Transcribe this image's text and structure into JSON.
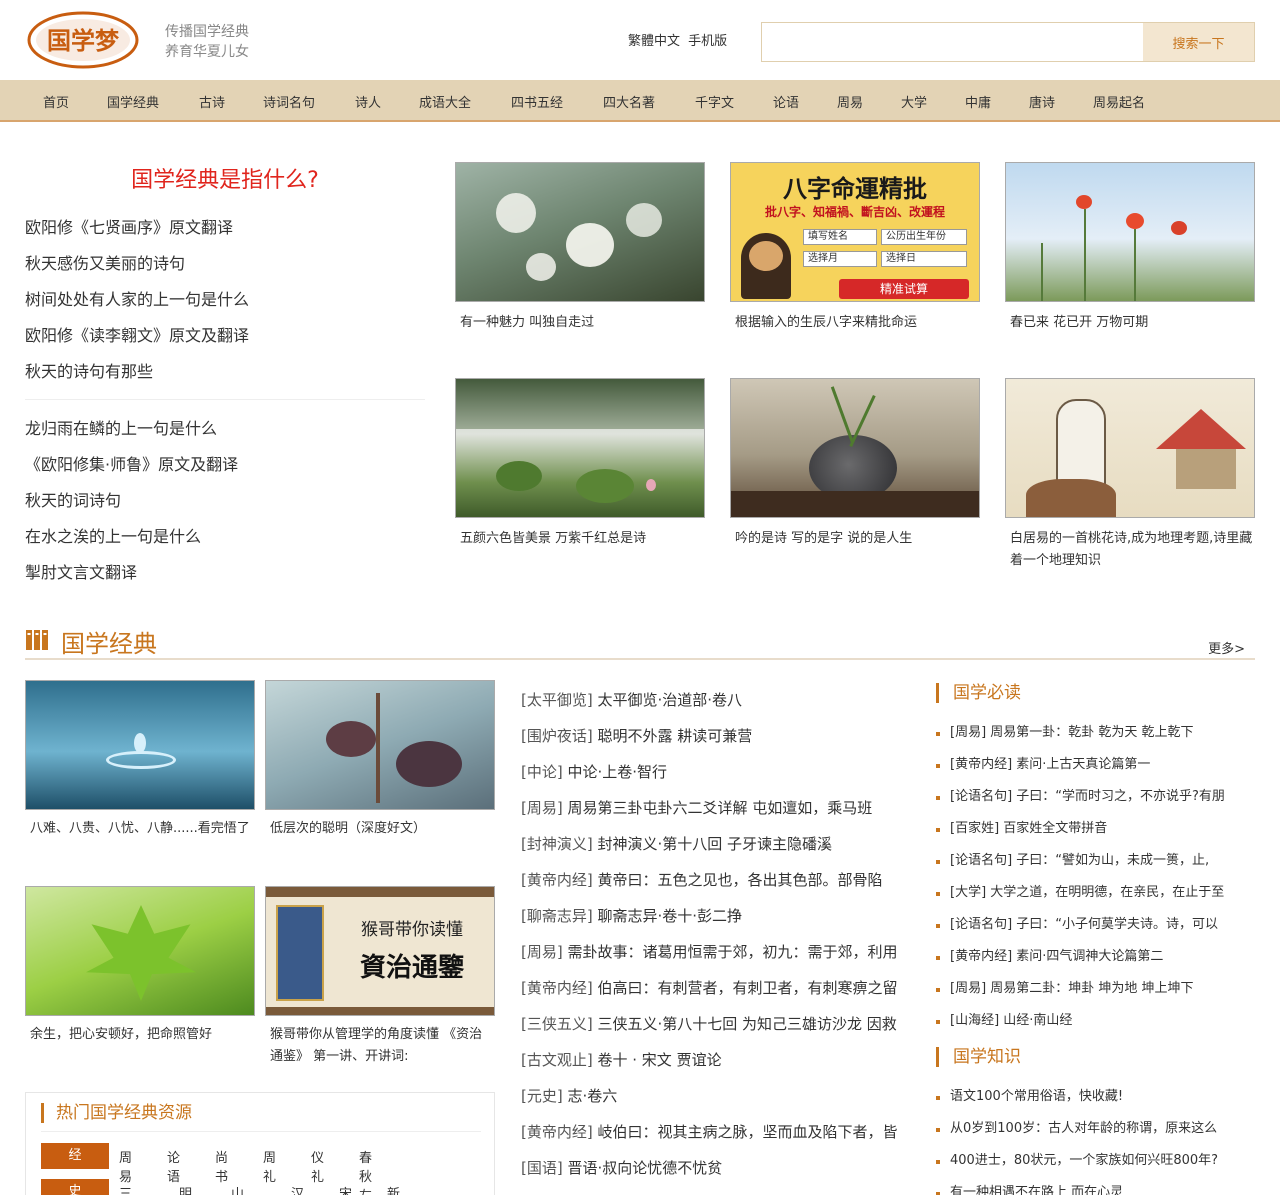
{
  "header": {
    "logo_text": "国学梦",
    "slogan_line1": "传播国学经典",
    "slogan_line2": "养育华夏儿女",
    "link_traditional": "繁體中文",
    "link_mobile": "手机版",
    "search_placeholder": "",
    "search_button": "搜索一下"
  },
  "nav": [
    "首页",
    "国学经典",
    "古诗",
    "诗词名句",
    "诗人",
    "成语大全",
    "四书五经",
    "四大名著",
    "千字文",
    "论语",
    "周易",
    "大学",
    "中庸",
    "唐诗",
    "周易起名"
  ],
  "lead": {
    "title": "国学经典是指什么?",
    "group1": [
      "欧阳修《七贤画序》原文翻译",
      "秋天感伤又美丽的诗句",
      "树间处处有人家的上一句是什么",
      "欧阳修《读李翱文》原文及翻译",
      "秋天的诗句有那些"
    ],
    "group2": [
      "龙归雨在鳞的上一句是什么",
      "《欧阳修集·师鲁》原文及翻译",
      "秋天的词诗句",
      "在水之涘的上一句是什么",
      "掣肘文言文翻译"
    ]
  },
  "features": [
    {
      "caption": "有一种魅力 叫独自走过",
      "icon": "blossom-photo"
    },
    {
      "caption": "根据输入的生辰八字来精批命运",
      "icon": "fortune-ad",
      "ad_title": "八字命運精批",
      "ad_sub": "批八字、知福禍、斷吉凶、改運程",
      "ad_f1": "填写姓名",
      "ad_f2": "公历出生年份",
      "ad_f3": "选择月",
      "ad_f4": "选择日",
      "ad_btn": "精准试算"
    },
    {
      "caption": "春已来 花已开 万物可期",
      "icon": "poppy-photo"
    },
    {
      "caption": "五颜六色皆美景 万紫千红总是诗",
      "icon": "lotus-photo"
    },
    {
      "caption": "吟的是诗 写的是字 说的是人生",
      "icon": "fossil-photo"
    },
    {
      "caption": "白居易的一首桃花诗,成为地理考题,诗里藏着一个地理知识",
      "icon": "painting-photo"
    }
  ],
  "section": {
    "title": "国学经典",
    "more": "更多>"
  },
  "classics": [
    {
      "caption": "八难、八贵、八忧、八静......看完悟了",
      "icon": "water-drop-photo"
    },
    {
      "caption": "低层次的聪明（深度好文）",
      "icon": "frost-plant-photo"
    },
    {
      "caption": "余生，把心安顿好，把命照管好",
      "icon": "maple-leaf-photo"
    },
    {
      "caption": "猴哥带你从管理学的角度读懂 《资治通鉴》 第一讲、开讲词:",
      "icon": "book-cover-photo",
      "banner1": "猴哥带你读懂",
      "banner2": "資治通鑒"
    }
  ],
  "articles": [
    {
      "cat": "[太平御览]",
      "title": "太平御览·治道部·卷八"
    },
    {
      "cat": "[围炉夜话]",
      "title": "聪明不外露 耕读可兼营"
    },
    {
      "cat": "[中论]",
      "title": "中论·上卷·智行"
    },
    {
      "cat": "[周易]",
      "title": "周易第三卦屯卦六二爻详解 屯如邅如，乘马班"
    },
    {
      "cat": "[封神演义]",
      "title": "封神演义·第十八回 子牙谏主隐磻溪"
    },
    {
      "cat": "[黄帝内经]",
      "title": "黄帝曰：五色之见也，各出其色部。部骨陷"
    },
    {
      "cat": "[聊斋志异]",
      "title": "聊斋志异·卷十·彭二挣"
    },
    {
      "cat": "[周易]",
      "title": "需卦故事：诸葛用恒需于郊，初九：需于郊，利用"
    },
    {
      "cat": "[黄帝内经]",
      "title": "伯高曰：有刺营者，有刺卫者，有刺寒痹之留"
    },
    {
      "cat": "[三侠五义]",
      "title": "三侠五义·第八十七回 为知己三雄访沙龙 因救"
    },
    {
      "cat": "[古文观止]",
      "title": "卷十 · 宋文 贾谊论"
    },
    {
      "cat": "[元史]",
      "title": "志·卷六"
    },
    {
      "cat": "[黄帝内经]",
      "title": "岐伯曰：视其主病之脉，坚而血及陷下者，皆"
    },
    {
      "cat": "[国语]",
      "title": "晋语·叔向论忧德不忧贫"
    }
  ],
  "must_read": {
    "title": "国学必读",
    "items": [
      {
        "cat": "[周易]",
        "title": "周易第一卦：乾卦 乾为天 乾上乾下"
      },
      {
        "cat": "[黄帝内经]",
        "title": "素问·上古天真论篇第一"
      },
      {
        "cat": "[论语名句]",
        "title": "子曰：“学而时习之，不亦说乎?有朋"
      },
      {
        "cat": "[百家姓]",
        "title": "百家姓全文带拼音"
      },
      {
        "cat": "[论语名句]",
        "title": "子曰：“譬如为山，未成一篑，止,"
      },
      {
        "cat": "[大学]",
        "title": "大学之道，在明明德，在亲民，在止于至"
      },
      {
        "cat": "[论语名句]",
        "title": "子曰：“小子何莫学夫诗。诗，可以"
      },
      {
        "cat": "[黄帝内经]",
        "title": "素问·四气调神大论篇第二"
      },
      {
        "cat": "[周易]",
        "title": "周易第二卦：坤卦 坤为地 坤上坤下"
      },
      {
        "cat": "[山海经]",
        "title": "山经·南山经"
      }
    ]
  },
  "knowledge": {
    "title": "国学知识",
    "items": [
      "语文100个常用俗语，快收藏!",
      "从0岁到100岁：古人对年龄的称谓，原来这么",
      "400进士，80状元，一个家族如何兴旺800年?",
      "有一种相遇不在路上 而在心灵"
    ]
  },
  "hot": {
    "title": "热门国学经典资源",
    "rows": [
      {
        "tag": "经",
        "links": [
          "周易",
          "论语",
          "尚书",
          "周礼",
          "仪礼",
          "春秋左传"
        ]
      },
      {
        "tag": "史",
        "links": [
          "三国志",
          "明史",
          "山海经",
          "汉书",
          "宋史",
          "新唐书"
        ]
      }
    ]
  },
  "colors": {
    "accent": "#c8761e",
    "nav_bg": "#e3d3b5",
    "headline_red": "#e0251d"
  }
}
